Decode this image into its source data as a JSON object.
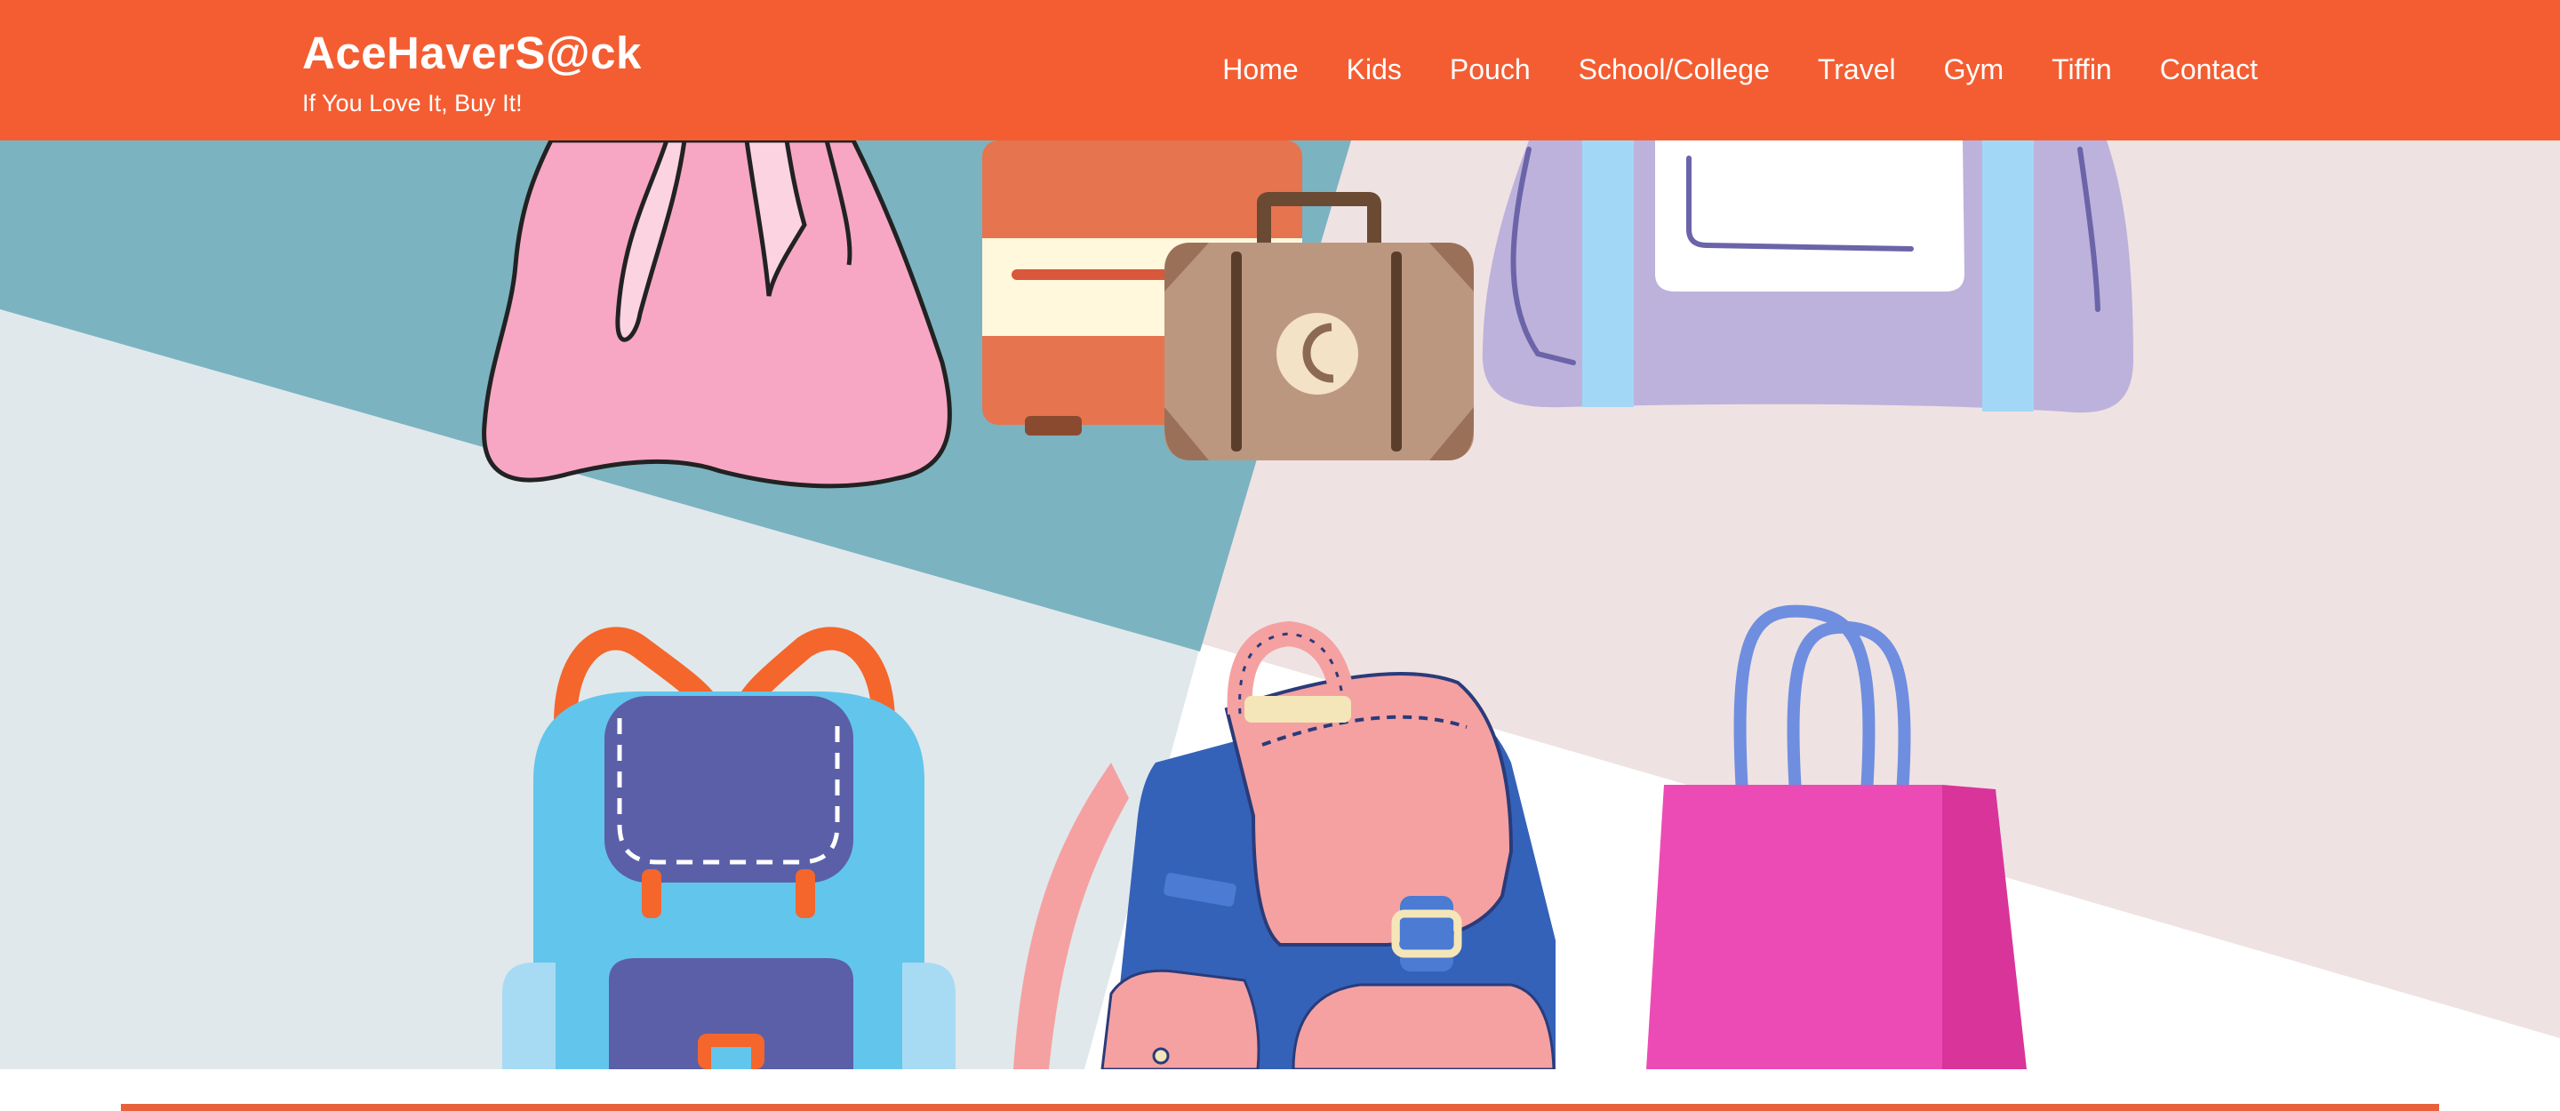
{
  "header": {
    "brand_title": "AceHaverS@ck",
    "brand_tagline": "If You Love It, Buy It!",
    "nav": [
      {
        "label": "Home"
      },
      {
        "label": "Kids"
      },
      {
        "label": "Pouch"
      },
      {
        "label": "School/College"
      },
      {
        "label": "Travel"
      },
      {
        "label": "Gym"
      },
      {
        "label": "Tiffin"
      },
      {
        "label": "Contact"
      }
    ]
  },
  "hero": {
    "illustration": "assorted-bags-banner",
    "items": [
      "drawstring-bag-icon",
      "suitcase-icon",
      "vintage-suitcase-icon",
      "duffel-bag-icon",
      "school-backpack-icon",
      "pink-backpack-icon",
      "shopping-bag-icon"
    ]
  },
  "colors": {
    "brand": "#f45d32",
    "divider": "#e8613a",
    "hero_teal": "#7bb3c1",
    "hero_grey": "#e0e8eb",
    "hero_blush": "#efe2e2"
  }
}
